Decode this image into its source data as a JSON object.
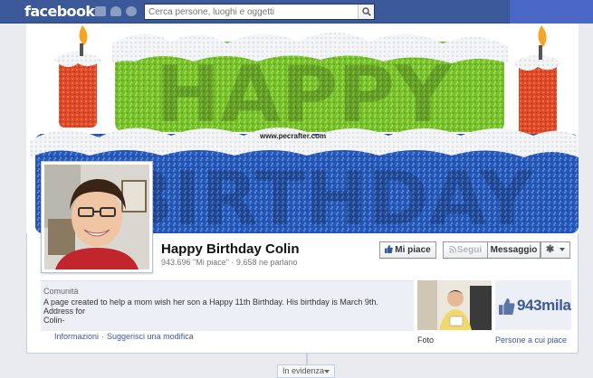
{
  "topbar": {
    "logo": "facebook",
    "search_placeholder": "Cerca persone, luoghi e oggetti",
    "icons": [
      "friend-requests-icon",
      "messages-icon",
      "notifications-icon",
      "search-icon"
    ]
  },
  "cover": {
    "headline_top": "HAPPY",
    "headline_bottom": "BIRTHDAY",
    "watermark": "www.pecrafter.com"
  },
  "profile": {
    "title": "Happy Birthday Colin",
    "stats": "943.696 \"Mi piace\" · 9.658 ne parlano"
  },
  "actions": {
    "like": "Mi piace",
    "follow": "Segui",
    "message": "Messaggio",
    "settings_icon": "gear-icon"
  },
  "about": {
    "category": "Comunità",
    "lines": [
      "A page created to help a mom wish her son a Happy 11th Birthday. His birthday is March 9th.",
      "Address for",
      "Colin-"
    ]
  },
  "links": {
    "info": "Informazioni",
    "separator": "·",
    "suggest": "Suggerisci una modifica"
  },
  "sidebar": {
    "photos_label": "Foto",
    "likes_count": "943mila",
    "likes_label": "Persone a cui piace"
  },
  "timeline": {
    "highlight": "In evidenza"
  },
  "colors": {
    "brand": "#3b5998",
    "balloon_green": "#7cc52b",
    "balloon_blue": "#2a5fbd",
    "candle_red": "#e2462a",
    "flame": "#f5a623"
  }
}
